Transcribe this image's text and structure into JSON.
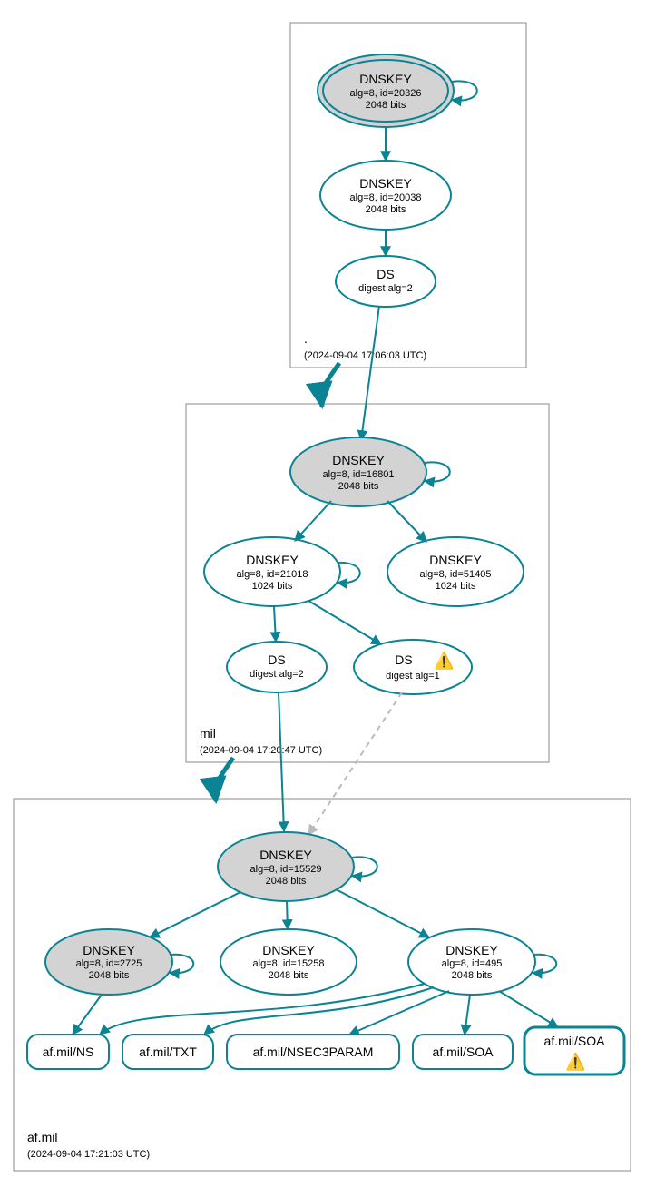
{
  "color": "#0a8494",
  "zones": {
    "root": {
      "label": ".",
      "timestamp": "(2024-09-04 17:06:03 UTC)"
    },
    "mil": {
      "label": "mil",
      "timestamp": "(2024-09-04 17:20:47 UTC)"
    },
    "afmil": {
      "label": "af.mil",
      "timestamp": "(2024-09-04 17:21:03 UTC)"
    }
  },
  "nodes": {
    "root_ksk": {
      "t": "DNSKEY",
      "l1": "alg=8, id=20326",
      "l2": "2048 bits"
    },
    "root_zsk": {
      "t": "DNSKEY",
      "l1": "alg=8, id=20038",
      "l2": "2048 bits"
    },
    "root_ds": {
      "t": "DS",
      "l1": "digest alg=2"
    },
    "mil_ksk": {
      "t": "DNSKEY",
      "l1": "alg=8, id=16801",
      "l2": "2048 bits"
    },
    "mil_zsk1": {
      "t": "DNSKEY",
      "l1": "alg=8, id=21018",
      "l2": "1024 bits"
    },
    "mil_zsk2": {
      "t": "DNSKEY",
      "l1": "alg=8, id=51405",
      "l2": "1024 bits"
    },
    "mil_ds1": {
      "t": "DS",
      "l1": "digest alg=2"
    },
    "mil_ds2": {
      "t": "DS",
      "l1": "digest alg=1",
      "warn": true
    },
    "af_ksk": {
      "t": "DNSKEY",
      "l1": "alg=8, id=15529",
      "l2": "2048 bits"
    },
    "af_k2": {
      "t": "DNSKEY",
      "l1": "alg=8, id=2725",
      "l2": "2048 bits"
    },
    "af_k3": {
      "t": "DNSKEY",
      "l1": "alg=8, id=15258",
      "l2": "2048 bits"
    },
    "af_k4": {
      "t": "DNSKEY",
      "l1": "alg=8, id=495",
      "l2": "2048 bits"
    },
    "rr_ns": {
      "t": "af.mil/NS"
    },
    "rr_txt": {
      "t": "af.mil/TXT"
    },
    "rr_nsec": {
      "t": "af.mil/NSEC3PARAM"
    },
    "rr_soa1": {
      "t": "af.mil/SOA"
    },
    "rr_soa2": {
      "t": "af.mil/SOA",
      "warn": true
    }
  }
}
